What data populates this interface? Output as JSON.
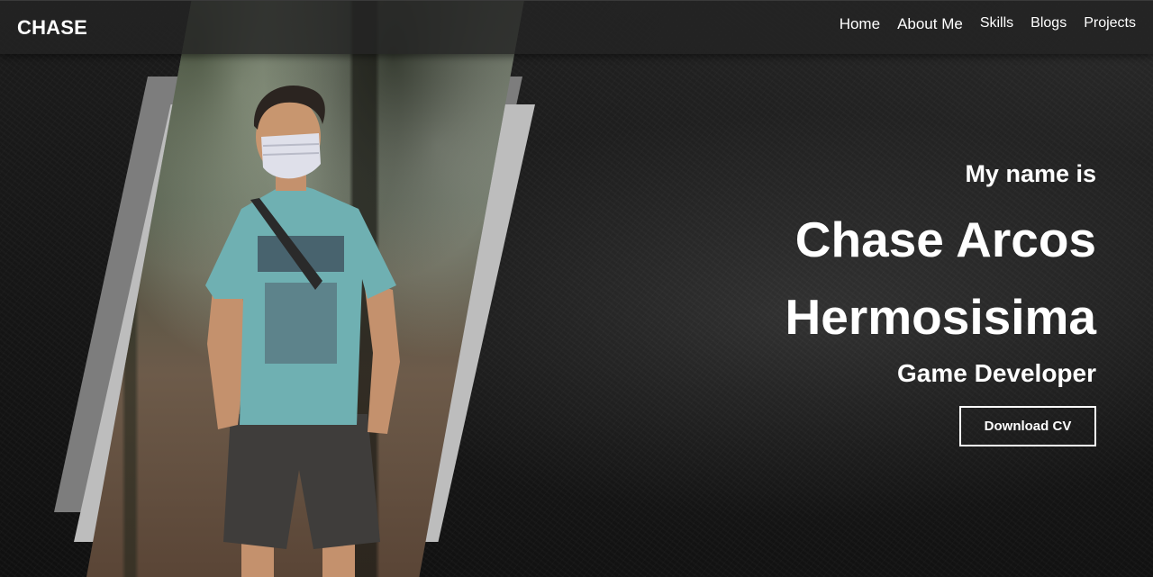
{
  "navbar": {
    "brand": "CHASE",
    "links": [
      "Home",
      "About Me",
      "Skills",
      "Blogs",
      "Projects"
    ]
  },
  "hero": {
    "intro": "My name is",
    "name_line1": "Chase Arcos",
    "name_line2": "Hermosisima",
    "role": "Game Developer",
    "cta": "Download CV"
  },
  "colors": {
    "background": "#141414",
    "text": "#ffffff",
    "frame_dark": "#7d7d7d",
    "frame_light": "#bdbdbd",
    "shirt": "#6fb0b2"
  }
}
